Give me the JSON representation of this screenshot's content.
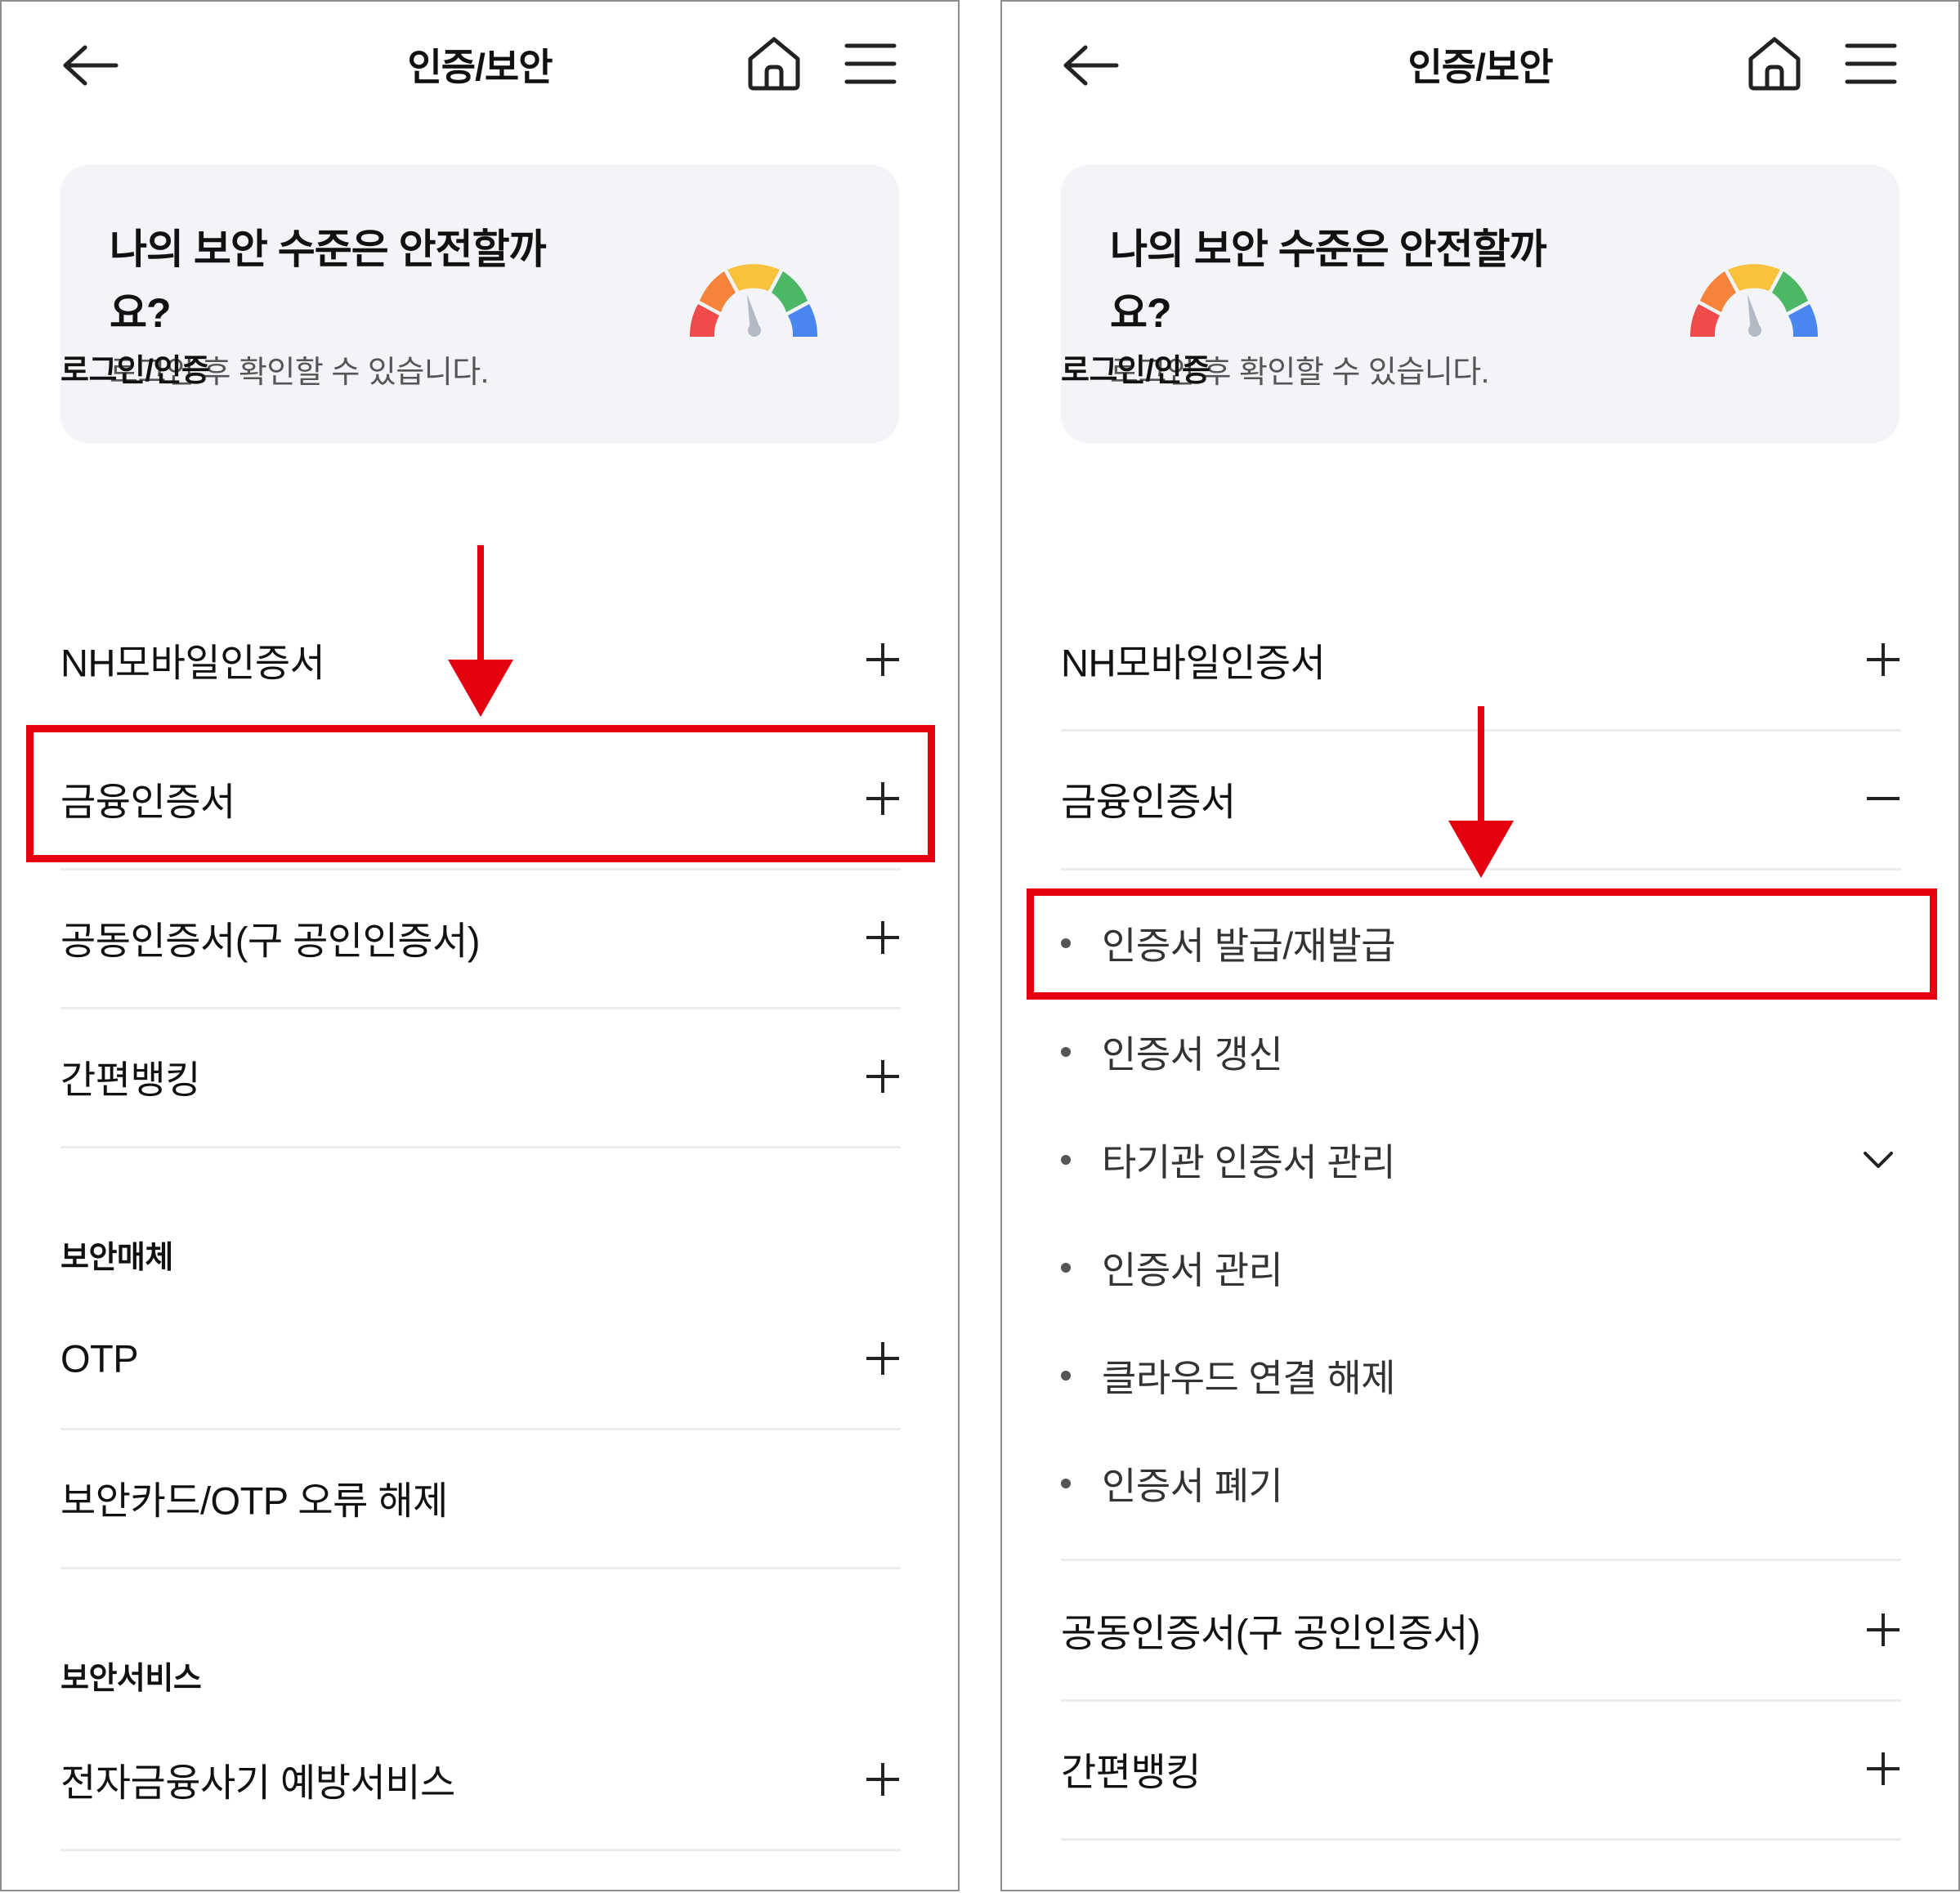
{
  "colors": {
    "highlight": "#e4000f",
    "card_bg": "#f3f4f7",
    "divider": "#ececec"
  },
  "icons": {
    "back": "arrow-left-icon",
    "home": "home-icon",
    "menu": "hamburger-menu-icon",
    "plus": "plus-icon",
    "minus": "minus-icon",
    "chevron": "chevron-down-icon",
    "gauge": "security-gauge-icon",
    "arrow": "red-down-arrow"
  },
  "left": {
    "title": "인증/보안",
    "card": {
      "title": "나의 보안 수준은 안전할까요?",
      "subtitle": "로그인 후 확인할 수 있습니다."
    },
    "sections": {
      "login": "로그인/인증",
      "media": "보안매체",
      "service": "보안서비스"
    },
    "items": {
      "nh": "NH모바일인증서",
      "finance": "금융인증서",
      "joint": "공동인증서(구 공인인증서)",
      "simple": "간편뱅킹",
      "otp": "OTP",
      "otp_error": "보안카드/OTP 오류 해제",
      "fraud": "전자금융사기 예방서비스"
    }
  },
  "right": {
    "title": "인증/보안",
    "card": {
      "title": "나의 보안 수준은 안전할까요?",
      "subtitle": "로그인 후 확인할 수 있습니다."
    },
    "sections": {
      "login": "로그인/인증"
    },
    "items": {
      "nh": "NH모바일인증서",
      "finance": "금융인증서",
      "joint": "공동인증서(구 공인인증서)",
      "simple": "간편뱅킹"
    },
    "subitems": [
      "인증서 발급/재발급",
      "인증서 갱신",
      "타기관 인증서 관리",
      "인증서 관리",
      "클라우드 연결 해제",
      "인증서 폐기"
    ]
  }
}
